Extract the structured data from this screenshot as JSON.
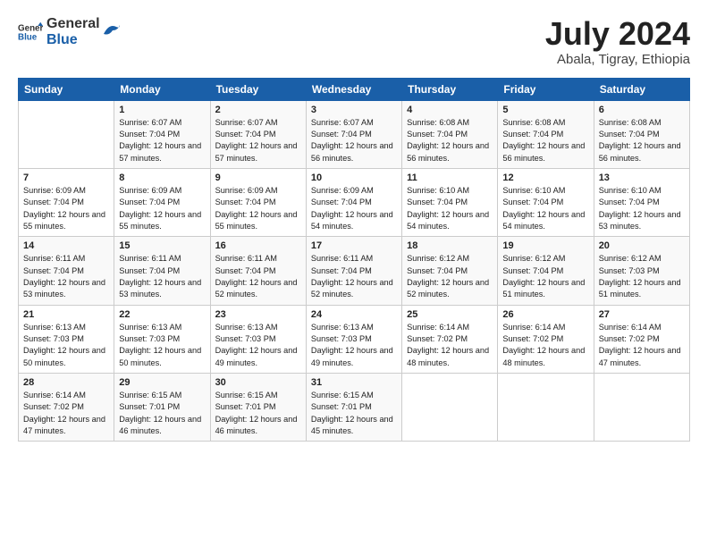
{
  "header": {
    "logo_general": "General",
    "logo_blue": "Blue",
    "title": "July 2024",
    "location": "Abala, Tigray, Ethiopia"
  },
  "calendar": {
    "days_of_week": [
      "Sunday",
      "Monday",
      "Tuesday",
      "Wednesday",
      "Thursday",
      "Friday",
      "Saturday"
    ],
    "weeks": [
      [
        {
          "day": "",
          "sunrise": "",
          "sunset": "",
          "daylight": ""
        },
        {
          "day": "1",
          "sunrise": "Sunrise: 6:07 AM",
          "sunset": "Sunset: 7:04 PM",
          "daylight": "Daylight: 12 hours and 57 minutes."
        },
        {
          "day": "2",
          "sunrise": "Sunrise: 6:07 AM",
          "sunset": "Sunset: 7:04 PM",
          "daylight": "Daylight: 12 hours and 57 minutes."
        },
        {
          "day": "3",
          "sunrise": "Sunrise: 6:07 AM",
          "sunset": "Sunset: 7:04 PM",
          "daylight": "Daylight: 12 hours and 56 minutes."
        },
        {
          "day": "4",
          "sunrise": "Sunrise: 6:08 AM",
          "sunset": "Sunset: 7:04 PM",
          "daylight": "Daylight: 12 hours and 56 minutes."
        },
        {
          "day": "5",
          "sunrise": "Sunrise: 6:08 AM",
          "sunset": "Sunset: 7:04 PM",
          "daylight": "Daylight: 12 hours and 56 minutes."
        },
        {
          "day": "6",
          "sunrise": "Sunrise: 6:08 AM",
          "sunset": "Sunset: 7:04 PM",
          "daylight": "Daylight: 12 hours and 56 minutes."
        }
      ],
      [
        {
          "day": "7",
          "sunrise": "Sunrise: 6:09 AM",
          "sunset": "Sunset: 7:04 PM",
          "daylight": "Daylight: 12 hours and 55 minutes."
        },
        {
          "day": "8",
          "sunrise": "Sunrise: 6:09 AM",
          "sunset": "Sunset: 7:04 PM",
          "daylight": "Daylight: 12 hours and 55 minutes."
        },
        {
          "day": "9",
          "sunrise": "Sunrise: 6:09 AM",
          "sunset": "Sunset: 7:04 PM",
          "daylight": "Daylight: 12 hours and 55 minutes."
        },
        {
          "day": "10",
          "sunrise": "Sunrise: 6:09 AM",
          "sunset": "Sunset: 7:04 PM",
          "daylight": "Daylight: 12 hours and 54 minutes."
        },
        {
          "day": "11",
          "sunrise": "Sunrise: 6:10 AM",
          "sunset": "Sunset: 7:04 PM",
          "daylight": "Daylight: 12 hours and 54 minutes."
        },
        {
          "day": "12",
          "sunrise": "Sunrise: 6:10 AM",
          "sunset": "Sunset: 7:04 PM",
          "daylight": "Daylight: 12 hours and 54 minutes."
        },
        {
          "day": "13",
          "sunrise": "Sunrise: 6:10 AM",
          "sunset": "Sunset: 7:04 PM",
          "daylight": "Daylight: 12 hours and 53 minutes."
        }
      ],
      [
        {
          "day": "14",
          "sunrise": "Sunrise: 6:11 AM",
          "sunset": "Sunset: 7:04 PM",
          "daylight": "Daylight: 12 hours and 53 minutes."
        },
        {
          "day": "15",
          "sunrise": "Sunrise: 6:11 AM",
          "sunset": "Sunset: 7:04 PM",
          "daylight": "Daylight: 12 hours and 53 minutes."
        },
        {
          "day": "16",
          "sunrise": "Sunrise: 6:11 AM",
          "sunset": "Sunset: 7:04 PM",
          "daylight": "Daylight: 12 hours and 52 minutes."
        },
        {
          "day": "17",
          "sunrise": "Sunrise: 6:11 AM",
          "sunset": "Sunset: 7:04 PM",
          "daylight": "Daylight: 12 hours and 52 minutes."
        },
        {
          "day": "18",
          "sunrise": "Sunrise: 6:12 AM",
          "sunset": "Sunset: 7:04 PM",
          "daylight": "Daylight: 12 hours and 52 minutes."
        },
        {
          "day": "19",
          "sunrise": "Sunrise: 6:12 AM",
          "sunset": "Sunset: 7:04 PM",
          "daylight": "Daylight: 12 hours and 51 minutes."
        },
        {
          "day": "20",
          "sunrise": "Sunrise: 6:12 AM",
          "sunset": "Sunset: 7:03 PM",
          "daylight": "Daylight: 12 hours and 51 minutes."
        }
      ],
      [
        {
          "day": "21",
          "sunrise": "Sunrise: 6:13 AM",
          "sunset": "Sunset: 7:03 PM",
          "daylight": "Daylight: 12 hours and 50 minutes."
        },
        {
          "day": "22",
          "sunrise": "Sunrise: 6:13 AM",
          "sunset": "Sunset: 7:03 PM",
          "daylight": "Daylight: 12 hours and 50 minutes."
        },
        {
          "day": "23",
          "sunrise": "Sunrise: 6:13 AM",
          "sunset": "Sunset: 7:03 PM",
          "daylight": "Daylight: 12 hours and 49 minutes."
        },
        {
          "day": "24",
          "sunrise": "Sunrise: 6:13 AM",
          "sunset": "Sunset: 7:03 PM",
          "daylight": "Daylight: 12 hours and 49 minutes."
        },
        {
          "day": "25",
          "sunrise": "Sunrise: 6:14 AM",
          "sunset": "Sunset: 7:02 PM",
          "daylight": "Daylight: 12 hours and 48 minutes."
        },
        {
          "day": "26",
          "sunrise": "Sunrise: 6:14 AM",
          "sunset": "Sunset: 7:02 PM",
          "daylight": "Daylight: 12 hours and 48 minutes."
        },
        {
          "day": "27",
          "sunrise": "Sunrise: 6:14 AM",
          "sunset": "Sunset: 7:02 PM",
          "daylight": "Daylight: 12 hours and 47 minutes."
        }
      ],
      [
        {
          "day": "28",
          "sunrise": "Sunrise: 6:14 AM",
          "sunset": "Sunset: 7:02 PM",
          "daylight": "Daylight: 12 hours and 47 minutes."
        },
        {
          "day": "29",
          "sunrise": "Sunrise: 6:15 AM",
          "sunset": "Sunset: 7:01 PM",
          "daylight": "Daylight: 12 hours and 46 minutes."
        },
        {
          "day": "30",
          "sunrise": "Sunrise: 6:15 AM",
          "sunset": "Sunset: 7:01 PM",
          "daylight": "Daylight: 12 hours and 46 minutes."
        },
        {
          "day": "31",
          "sunrise": "Sunrise: 6:15 AM",
          "sunset": "Sunset: 7:01 PM",
          "daylight": "Daylight: 12 hours and 45 minutes."
        },
        {
          "day": "",
          "sunrise": "",
          "sunset": "",
          "daylight": ""
        },
        {
          "day": "",
          "sunrise": "",
          "sunset": "",
          "daylight": ""
        },
        {
          "day": "",
          "sunrise": "",
          "sunset": "",
          "daylight": ""
        }
      ]
    ]
  }
}
